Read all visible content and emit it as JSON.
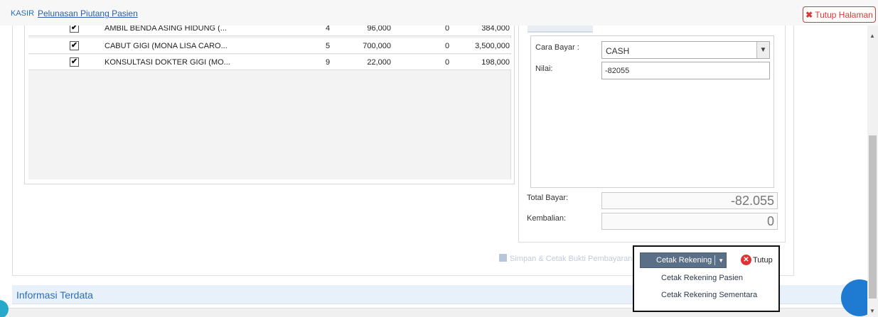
{
  "header": {
    "breadcrumb_root": "KASIR",
    "page_title": "Pelunasan Piutang Pasien",
    "close_page_label": "Tutup Halaman"
  },
  "items": [
    {
      "checked": true,
      "name": "AMBIL BENDA ASING HIDUNG (...",
      "qty": "4",
      "price": "96,000",
      "discount": "0",
      "total": "384,000"
    },
    {
      "checked": true,
      "name": "CABUT GIGI (MONA LISA CARO...",
      "qty": "5",
      "price": "700,000",
      "discount": "0",
      "total": "3,500,000"
    },
    {
      "checked": true,
      "name": "KONSULTASI DOKTER GIGI (MO...",
      "qty": "9",
      "price": "22,000",
      "discount": "0",
      "total": "198,000"
    }
  ],
  "payment": {
    "method_label": "Cara Bayar :",
    "method_value": "CASH",
    "nilai_label": "Nilai:",
    "nilai_value": "-82055",
    "total_label": "Total Bayar:",
    "total_value": "-82.055",
    "change_label": "Kembalian:",
    "change_value": "0"
  },
  "actions": {
    "save_print_label": "Simpan & Cetak Bukti Pembayaran",
    "print_account_label": "Cetak Rekening",
    "close_label": "Tutup",
    "print_menu": [
      "Cetak Rekening Pasien",
      "Cetak Rekening Sementara"
    ]
  },
  "section": {
    "title": "Informasi Terdata"
  }
}
